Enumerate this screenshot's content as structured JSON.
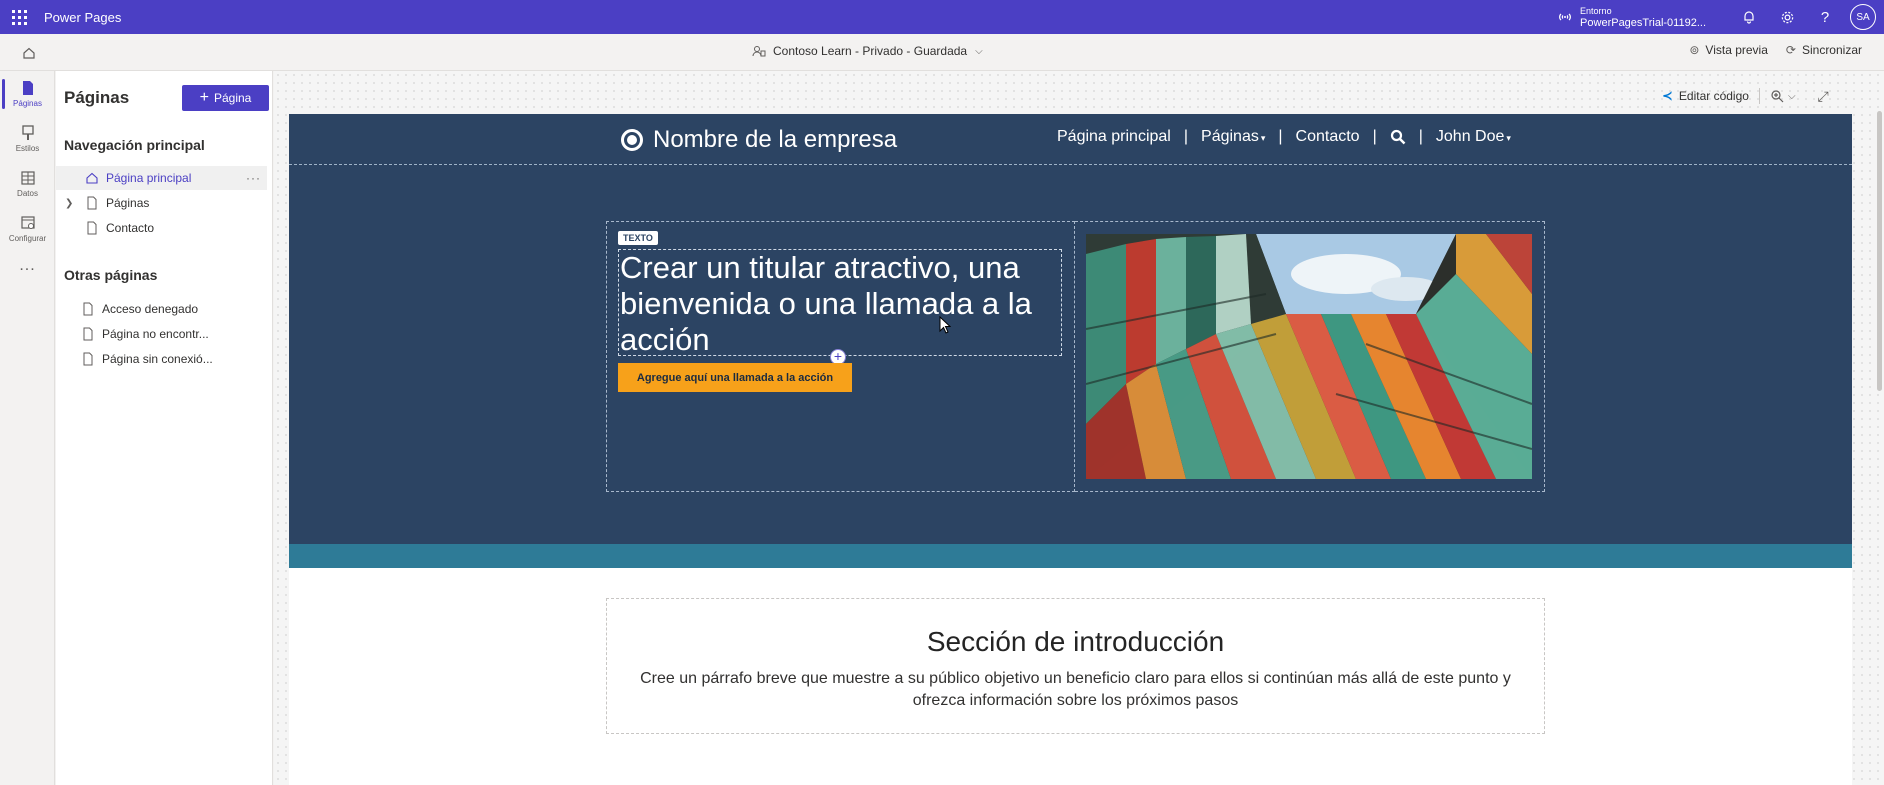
{
  "topbar": {
    "app_title": "Power Pages",
    "environment_label": "Entorno",
    "environment_name": "PowerPagesTrial-01192...",
    "avatar_initials": "SA"
  },
  "cmdbar": {
    "site_info": "Contoso Learn - Privado - Guardada",
    "preview_label": "Vista previa",
    "sync_label": "Sincronizar"
  },
  "rail": {
    "items": [
      {
        "label": "Páginas",
        "icon": "page-icon",
        "active": true
      },
      {
        "label": "Estilos",
        "icon": "brush-icon",
        "active": false
      },
      {
        "label": "Datos",
        "icon": "table-icon",
        "active": false
      },
      {
        "label": "Configurar",
        "icon": "settings-icon",
        "active": false
      }
    ],
    "more": "..."
  },
  "panel": {
    "title": "Páginas",
    "add_button": "Página",
    "main_nav_title": "Navegación principal",
    "main_nav": [
      {
        "label": "Página principal",
        "selected": true,
        "icon": "home-icon"
      },
      {
        "label": "Páginas",
        "expandable": true,
        "icon": "page-icon"
      },
      {
        "label": "Contacto",
        "icon": "page-icon"
      }
    ],
    "other_title": "Otras páginas",
    "other_pages": [
      {
        "label": "Acceso denegado"
      },
      {
        "label": "Página no encontr..."
      },
      {
        "label": "Página sin conexió..."
      }
    ]
  },
  "canvas": {
    "edit_code_label": "Editar código"
  },
  "site": {
    "brand_name": "Nombre de la empresa",
    "menu": {
      "home": "Página principal",
      "pages": "Páginas",
      "contact": "Contacto",
      "user": "John Doe"
    },
    "hero": {
      "tag": "TEXTO",
      "headline": "Crear un titular atractivo, una bienvenida o una llamada a la acción",
      "cta": "Agregue aquí una llamada a la acción"
    },
    "intro": {
      "title": "Sección de introducción",
      "text": "Cree un párrafo breve que muestre a su público objetivo un beneficio claro para ellos si continúan más allá de este punto y ofrezca información sobre los próximos pasos"
    },
    "colors": {
      "brand": "#4b3fc4",
      "site_nav": "#2c4463",
      "band": "#2e7b97",
      "cta": "#f7a11a"
    }
  }
}
